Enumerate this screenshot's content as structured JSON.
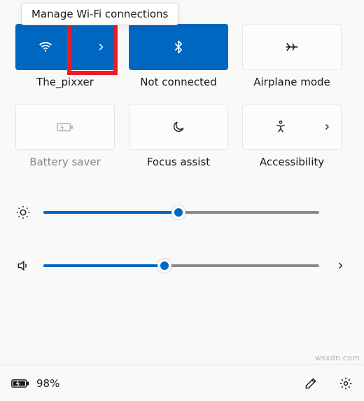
{
  "tooltip": "Manage Wi-Fi connections",
  "tiles": {
    "wifi": {
      "label": "The_pixxer",
      "active": true
    },
    "bluetooth": {
      "label": "Not connected",
      "active": true
    },
    "airplane": {
      "label": "Airplane mode",
      "active": false
    },
    "battery_saver": {
      "label": "Battery saver",
      "active": false,
      "disabled": true
    },
    "focus_assist": {
      "label": "Focus assist",
      "active": false
    },
    "accessibility": {
      "label": "Accessibility",
      "active": false
    }
  },
  "sliders": {
    "brightness": 49,
    "volume": 44
  },
  "footer": {
    "battery_percent": "98%"
  },
  "watermark": "wsxdn.com"
}
